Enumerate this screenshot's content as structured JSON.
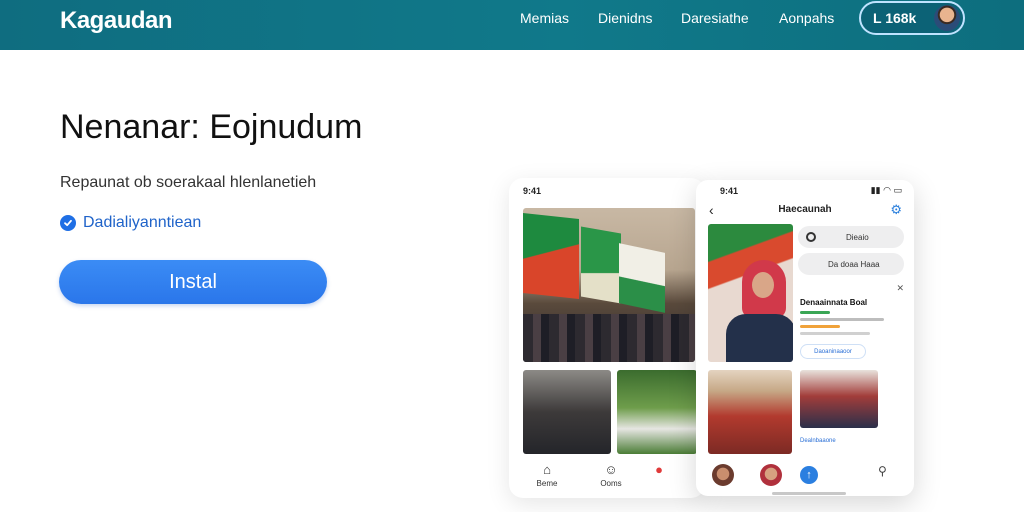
{
  "header": {
    "logo": "Kagaudan",
    "nav": [
      "Memias",
      "Dienidns",
      "Daresiathe",
      "Aonpahs"
    ],
    "user_label": "L 168k"
  },
  "hero": {
    "title": "Nenanar: Eojnudum",
    "subtitle": "Repaunat ob soerakaal hlenlanetieh",
    "verified_label": "Dadialiyanntiean",
    "install_label": "Instal"
  },
  "phone_back": {
    "status_time": "9:41",
    "nav": [
      {
        "icon": "home-icon",
        "label": "Beme"
      },
      {
        "icon": "smile-icon",
        "label": "Ooms"
      },
      {
        "icon": "notification-icon",
        "label": ""
      }
    ]
  },
  "phone_front": {
    "status_time": "9:41",
    "title": "Haecaunah",
    "chips": [
      "Dieaio",
      "Da doaa Haaa"
    ],
    "event_title": "Denaainnata Boal",
    "link_label": "Daoaninaaoor",
    "bottom_link": "Dealnbaaone"
  },
  "colors": {
    "header": "#10798a",
    "accent": "#2a76ea",
    "verified": "#1f6fe5"
  }
}
